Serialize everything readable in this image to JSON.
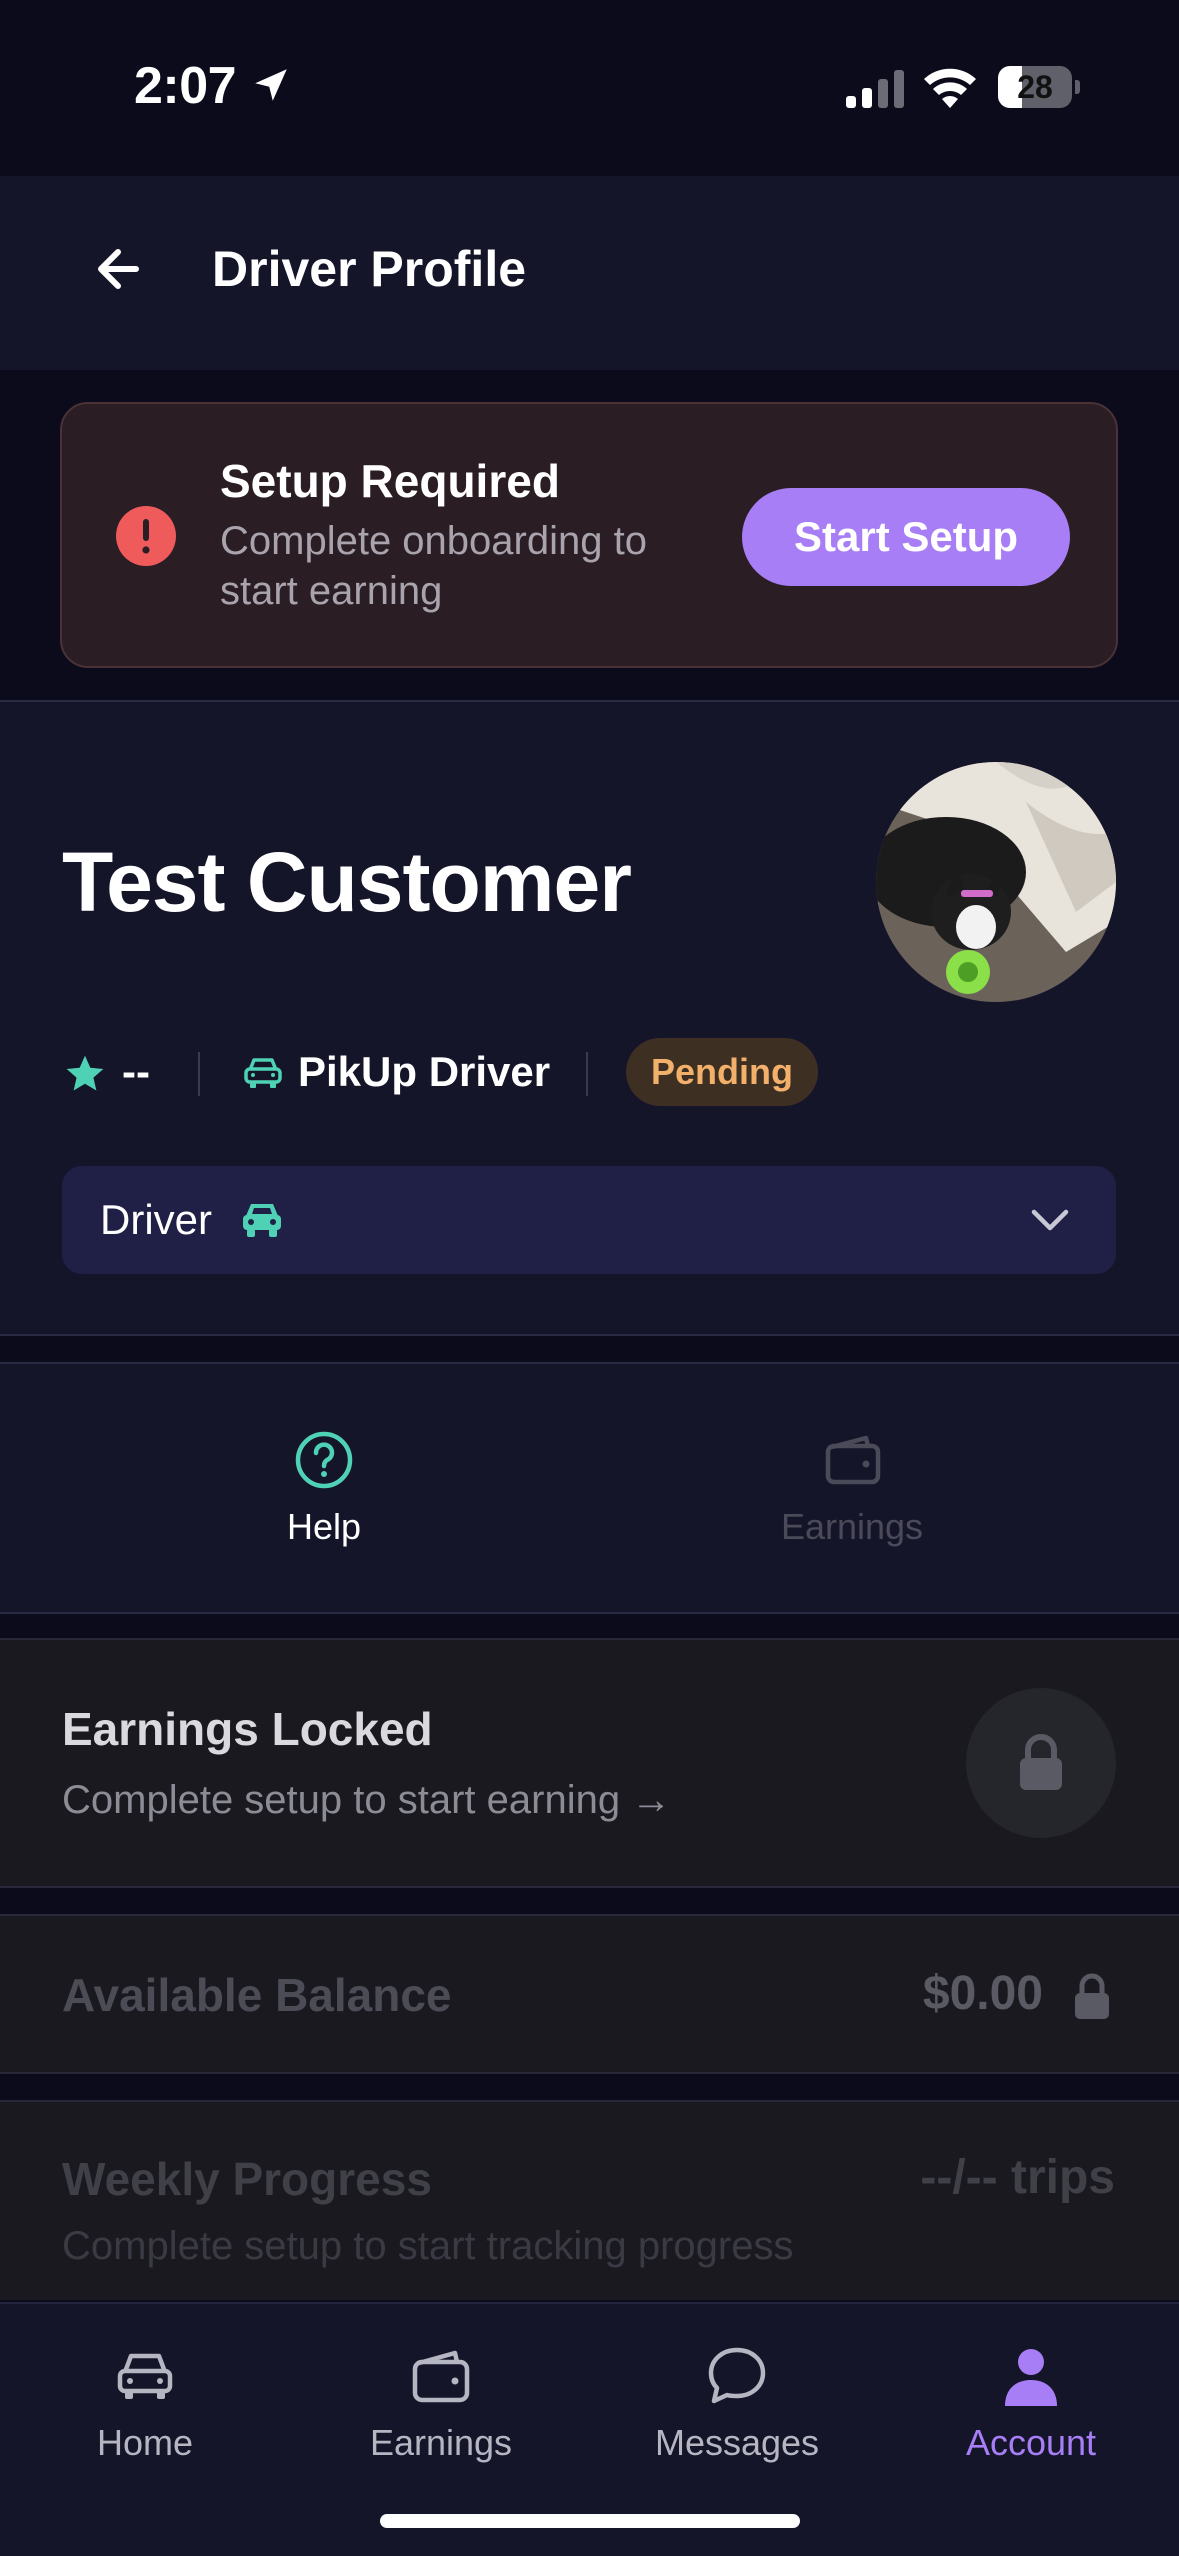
{
  "status_bar": {
    "time": "2:07",
    "battery": "28"
  },
  "header": {
    "title": "Driver Profile"
  },
  "setup_banner": {
    "title": "Setup Required",
    "description": "Complete onboarding to start earning",
    "button_label": "Start Setup"
  },
  "profile": {
    "name": "Test Customer",
    "rating": "--",
    "role_label": "PikUp Driver",
    "status_badge": "Pending",
    "role_select_value": "Driver"
  },
  "actions": [
    {
      "label": "Help",
      "icon": "help-circle-icon",
      "enabled": true
    },
    {
      "label": "Earnings",
      "icon": "wallet-icon",
      "enabled": false
    }
  ],
  "earnings_locked": {
    "title": "Earnings Locked",
    "description": "Complete setup to start earning →"
  },
  "balance": {
    "label": "Available Balance",
    "value": "$0.00"
  },
  "weekly_progress": {
    "label": "Weekly Progress",
    "value": "--/-- trips",
    "description": "Complete setup to start tracking progress"
  },
  "tabs": [
    {
      "label": "Home",
      "icon": "car-icon",
      "active": false
    },
    {
      "label": "Earnings",
      "icon": "wallet-icon",
      "active": false
    },
    {
      "label": "Messages",
      "icon": "chat-bubble-icon",
      "active": false
    },
    {
      "label": "Account",
      "icon": "person-icon",
      "active": true
    }
  ],
  "colors": {
    "accent": "#a77ef5",
    "teal": "#4fd1b5",
    "pending": "#f3b06a",
    "alert": "#ef5b5b",
    "background": "#0b0b1c"
  }
}
